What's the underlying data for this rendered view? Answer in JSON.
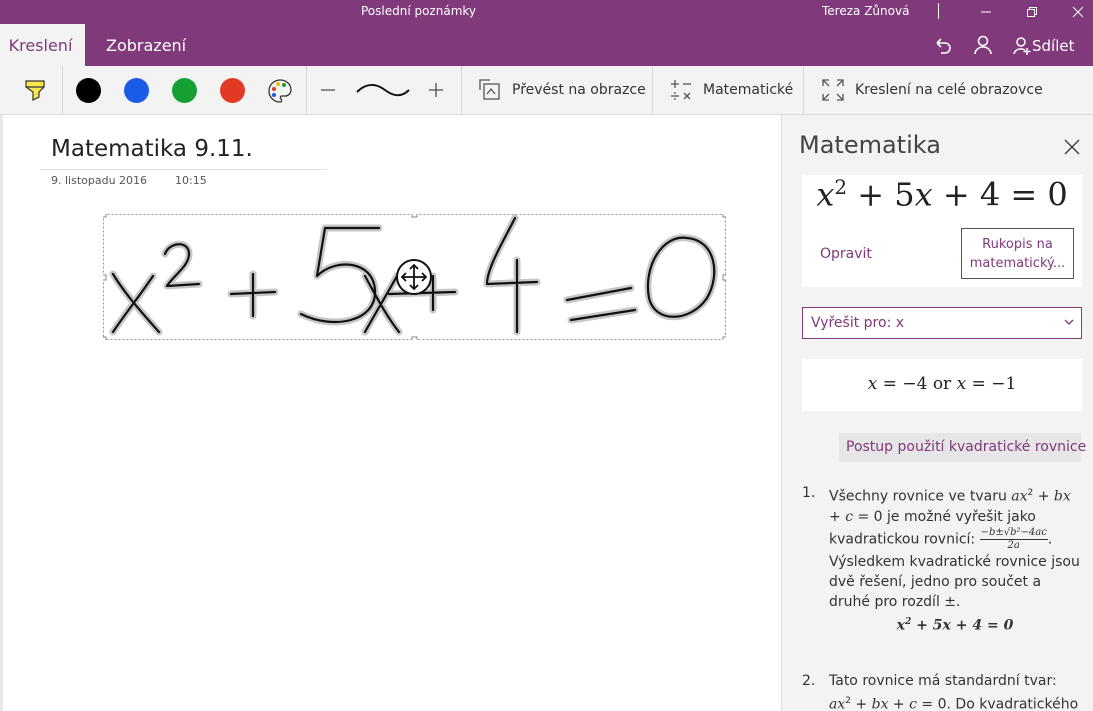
{
  "window": {
    "title": "Poslední poznámky",
    "user": "Tereza Zůnová"
  },
  "tabs": [
    {
      "label": "Kreslení",
      "active": true
    },
    {
      "label": "Zobrazení",
      "active": false
    }
  ],
  "header_actions": {
    "share_label": "Sdílet"
  },
  "ribbon": {
    "colors": [
      "#000000",
      "#1A5CE6",
      "#16A034",
      "#E03A24"
    ],
    "convert_label": "Převést na obrazce",
    "math_label": "Matematické",
    "fullscreen_label": "Kreslení na celé obrazovce"
  },
  "page": {
    "title": "Matematika 9.11.",
    "date": "9. listopadu 2016",
    "time": "10:15"
  },
  "math_pane": {
    "title": "Matematika",
    "fix_label": "Opravit",
    "ink_to_math_label": "Rukopis na matematický...",
    "solve_select": "Vyřešit pro: x",
    "result_x1": "−4",
    "result_or": "or",
    "result_x2": "−1",
    "steps_dropdown": "Postup použití kvadratické rovnice",
    "steps": [
      {
        "number": "1.",
        "part1": "Všechny rovnice ve tvaru",
        "part2": "je možné vyřešit jako kvadratickou rovnicí:",
        "part3": "Výsledkem kvadratické rovnice jsou dvě řešení, jedno pro součet a druhé pro rozdíl"
      },
      {
        "number": "2.",
        "part1": "Tato rovnice má standardní tvar:",
        "part2": "Do kvadratického"
      }
    ]
  },
  "accent_color": "#80397B"
}
